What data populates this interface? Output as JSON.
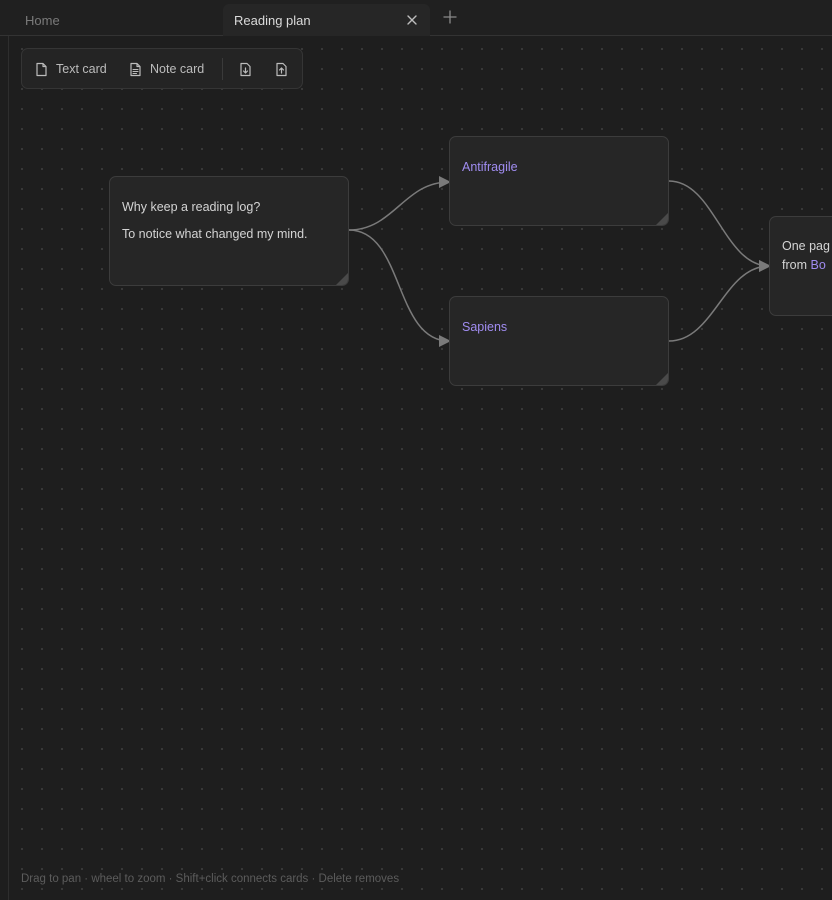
{
  "tabs": [
    {
      "label": "Home"
    },
    {
      "label": "Reading plan"
    }
  ],
  "toolbar": {
    "text_card_label": "Text card",
    "note_card_label": "Note card"
  },
  "cards": {
    "intro": {
      "line1": "Why keep a reading log?",
      "line2": "To notice what changed my mind."
    },
    "antifragile": {
      "title": "Antifragile"
    },
    "sapiens": {
      "title": "Sapiens"
    },
    "summary": {
      "line1": "One pag",
      "line2_prefix": "from ",
      "line2_link": "Bo"
    }
  },
  "hint": "Drag to pan · wheel to zoom · Shift+click connects cards · Delete removes",
  "colors": {
    "accent_link": "#a08cf0",
    "background": "#1e1e1e",
    "card": "#262626"
  }
}
